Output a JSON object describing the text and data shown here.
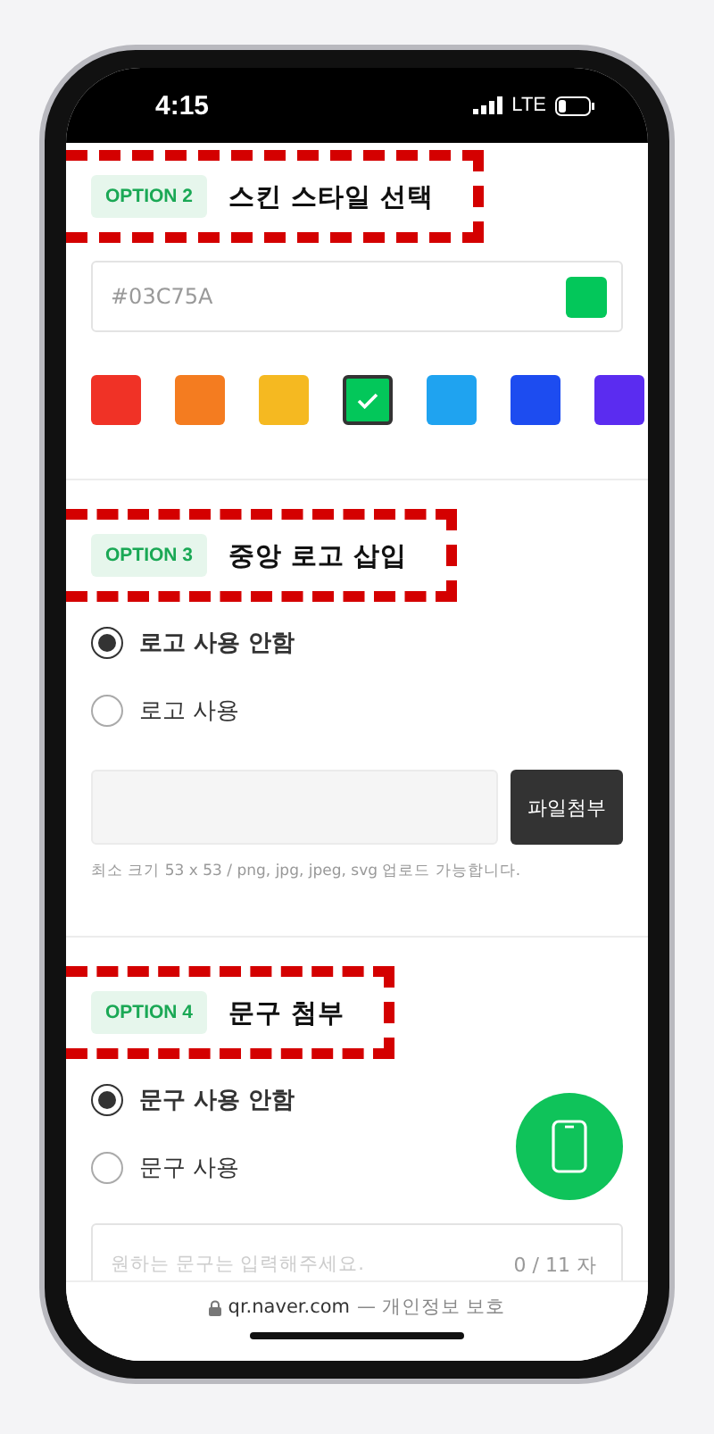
{
  "status_bar": {
    "time": "4:15",
    "network": "LTE"
  },
  "sections": [
    {
      "kind": "color",
      "badge": "OPTION 2",
      "title": "스킨 스타일 선택",
      "color_value": "#03C75A",
      "swatches": [
        {
          "color": "#f03226",
          "selected": false
        },
        {
          "color": "#f47c20",
          "selected": false
        },
        {
          "color": "#f5b921",
          "selected": false
        },
        {
          "color": "#03c75a",
          "selected": true
        },
        {
          "color": "#1fa3f0",
          "selected": false
        },
        {
          "color": "#1d4cf0",
          "selected": false
        },
        {
          "color": "#5b2cf0",
          "selected": false
        }
      ]
    },
    {
      "kind": "logo",
      "badge": "OPTION 3",
      "title": "중앙 로고 삽입",
      "options": [
        {
          "label": "로고 사용 안함",
          "selected": true
        },
        {
          "label": "로고 사용",
          "selected": false
        }
      ],
      "upload_button": "파일첨부",
      "hint": "최소 크기 53 x 53 / png, jpg, jpeg, svg 업로드 가능합니다."
    },
    {
      "kind": "phrase",
      "badge": "OPTION 4",
      "title": "문구 첨부",
      "options": [
        {
          "label": "문구 사용 안함",
          "selected": true
        },
        {
          "label": "문구 사용",
          "selected": false
        }
      ],
      "placeholder": "원하는 문구는 입력해주세요.",
      "counter": "0 / 11 자"
    }
  ],
  "address_bar": {
    "url": "qr.naver.com",
    "note": "— 개인정보 보호"
  }
}
